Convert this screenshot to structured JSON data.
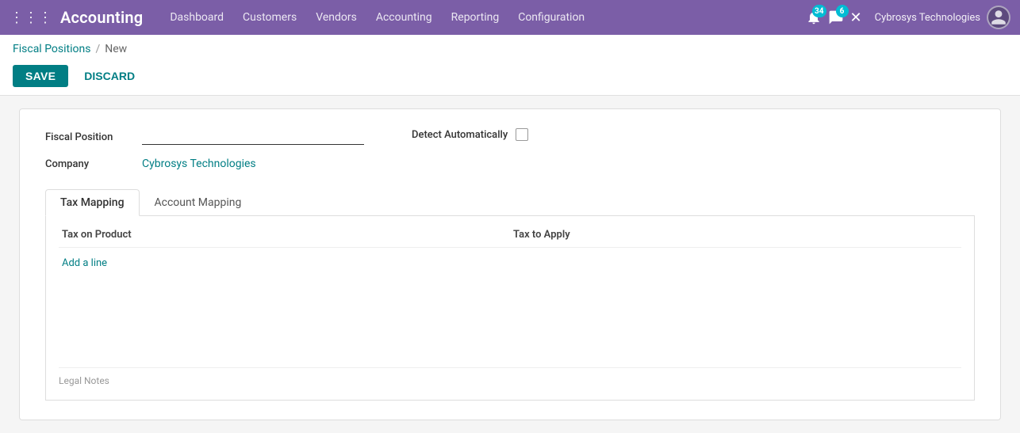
{
  "app": {
    "title": "Accounting",
    "grid_icon": "⊞"
  },
  "nav": {
    "items": [
      {
        "label": "Dashboard",
        "id": "dashboard"
      },
      {
        "label": "Customers",
        "id": "customers"
      },
      {
        "label": "Vendors",
        "id": "vendors"
      },
      {
        "label": "Accounting",
        "id": "accounting"
      },
      {
        "label": "Reporting",
        "id": "reporting"
      },
      {
        "label": "Configuration",
        "id": "configuration"
      }
    ]
  },
  "topbar": {
    "notification_count": "34",
    "message_count": "6",
    "company": "Cybrosys Technologies",
    "close_icon": "✕"
  },
  "breadcrumb": {
    "parent": "Fiscal Positions",
    "separator": "/",
    "current": "New"
  },
  "actions": {
    "save_label": "SAVE",
    "discard_label": "DISCARD"
  },
  "form": {
    "fiscal_position_label": "Fiscal Position",
    "fiscal_position_placeholder": "",
    "company_label": "Company",
    "company_value": "Cybrosys Technologies",
    "detect_automatically_label": "Detect Automatically"
  },
  "tabs": [
    {
      "label": "Tax Mapping",
      "id": "tax-mapping",
      "active": true
    },
    {
      "label": "Account Mapping",
      "id": "account-mapping",
      "active": false
    }
  ],
  "tax_mapping_table": {
    "columns": [
      {
        "label": "Tax on Product"
      },
      {
        "label": "Tax to Apply"
      }
    ],
    "add_line_label": "Add a line"
  },
  "legal_notes": {
    "label": "Legal Notes"
  }
}
